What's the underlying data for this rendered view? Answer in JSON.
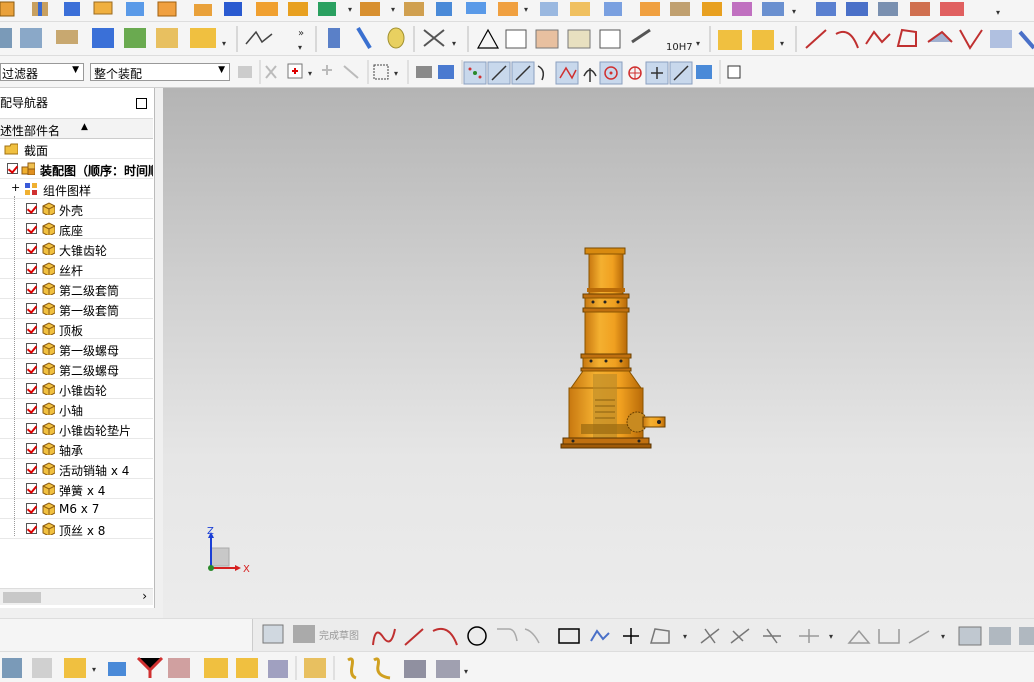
{
  "filters": {
    "type_filter": "过滤器",
    "scope_filter": "整个装配"
  },
  "navigator": {
    "title": "配导航器",
    "column_header": "述性部件名",
    "section_node": "截面",
    "root_node": "装配图（顺序：时间顺",
    "pattern_node": "组件图样",
    "components": [
      "外壳",
      "底座",
      "大锥齿轮",
      "丝杆",
      "第二级套筒",
      "第一级套筒",
      "顶板",
      "第一级螺母",
      "第二级螺母",
      "小锥齿轮",
      "小轴",
      "小锥齿轮垫片",
      "轴承",
      "活动销轴 x 4",
      "弹簧 x 4",
      "M6 x 7",
      "顶丝 x 8"
    ]
  },
  "toolbar": {
    "fit_label": "10H7",
    "finish_sketch_label": "完成草图"
  },
  "triad": {
    "z_label": "Z",
    "x_label": "X"
  },
  "colors": {
    "model_orange": "#e8a020",
    "checkbox_red": "#d00000",
    "axis_blue": "#1a3fd6",
    "axis_red": "#d62020"
  }
}
